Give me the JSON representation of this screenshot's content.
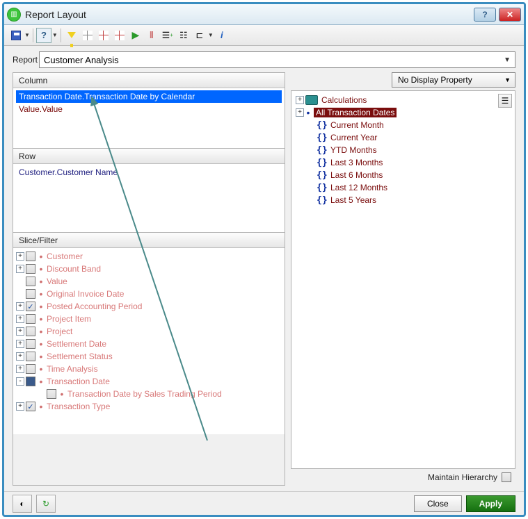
{
  "title": "Report Layout",
  "report": {
    "label": "Report",
    "value": "Customer Analysis"
  },
  "panels": {
    "column": "Column",
    "row": "Row",
    "slice": "Slice/Filter"
  },
  "column_fields": [
    {
      "text": "Transaction Date.Transaction Date by Calendar",
      "selected": true
    },
    {
      "text": "Value.Value",
      "selected": false
    }
  ],
  "row_fields": [
    {
      "text": "Customer.Customer Name"
    }
  ],
  "slice_items": [
    {
      "label": "Customer",
      "exp": "+",
      "checked": false,
      "indent": 0
    },
    {
      "label": "Discount Band",
      "exp": "+",
      "checked": false,
      "indent": 0
    },
    {
      "label": "Value",
      "exp": "",
      "checked": false,
      "indent": 0
    },
    {
      "label": "Original Invoice Date",
      "exp": "",
      "checked": false,
      "indent": 0
    },
    {
      "label": "Posted Accounting Period",
      "exp": "+",
      "checked": true,
      "indent": 0
    },
    {
      "label": "Project Item",
      "exp": "+",
      "checked": false,
      "indent": 0
    },
    {
      "label": "Project",
      "exp": "+",
      "checked": false,
      "indent": 0
    },
    {
      "label": "Settlement Date",
      "exp": "+",
      "checked": false,
      "indent": 0
    },
    {
      "label": "Settlement Status",
      "exp": "+",
      "checked": false,
      "indent": 0
    },
    {
      "label": "Time Analysis",
      "exp": "+",
      "checked": false,
      "indent": 0
    },
    {
      "label": "Transaction Date",
      "exp": "-",
      "checked": false,
      "dark": true,
      "indent": 0
    },
    {
      "label": "Transaction Date by Sales Trading Period",
      "exp": "",
      "checked": false,
      "indent": 1
    },
    {
      "label": "Transaction Type",
      "exp": "+",
      "checked": true,
      "indent": 0
    }
  ],
  "display_property": "No Display Property",
  "calc_tree": {
    "root1": "Calculations",
    "root2": "All Transaction Dates",
    "children": [
      "Current Month",
      "Current Year",
      "YTD Months",
      "Last 3 Months",
      "Last 6 Months",
      "Last 12 Months",
      "Last 5 Years"
    ]
  },
  "maintain_label": "Maintain Hierarchy",
  "buttons": {
    "close": "Close",
    "apply": "Apply"
  }
}
